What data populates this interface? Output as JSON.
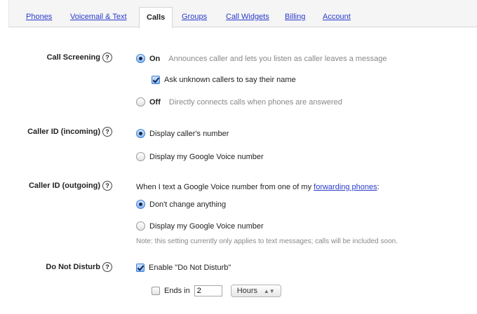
{
  "tabs": [
    {
      "label": "Phones",
      "active": false
    },
    {
      "label": "Voicemail & Text",
      "active": false
    },
    {
      "label": "Calls",
      "active": true
    },
    {
      "label": "Groups",
      "active": false
    },
    {
      "label": "Call Widgets",
      "active": false
    },
    {
      "label": "Billing",
      "active": false
    },
    {
      "label": "Account",
      "active": false
    }
  ],
  "help_glyph": "?",
  "call_screening": {
    "label": "Call Screening",
    "on_label": "On",
    "on_desc": "Announces caller and lets you listen as caller leaves a message",
    "ask_name_label": "Ask unknown callers to say their name",
    "ask_name_checked": true,
    "off_label": "Off",
    "off_desc": "Directly connects calls when phones are answered",
    "selected": "On"
  },
  "caller_id_incoming": {
    "label": "Caller ID (incoming)",
    "options": [
      "Display caller's number",
      "Display my Google Voice number"
    ],
    "selected": "Display caller's number"
  },
  "caller_id_outgoing": {
    "label": "Caller ID (outgoing)",
    "intro_text": "When I text a Google Voice number from one of my",
    "intro_link": "forwarding phones",
    "intro_suffix": ":",
    "options": [
      "Don't change anything",
      "Display my Google Voice number"
    ],
    "selected": "Don't change anything",
    "note": "Note: this setting currently only applies to text messages; calls will be included soon."
  },
  "do_not_disturb": {
    "label": "Do Not Disturb",
    "enable_label": "Enable \"Do Not Disturb\"",
    "enable_checked": true,
    "ends_in_label": "Ends in",
    "ends_in_checked": false,
    "ends_in_value": "2",
    "unit_value": "Hours",
    "unit_arrows": "▲▼"
  }
}
